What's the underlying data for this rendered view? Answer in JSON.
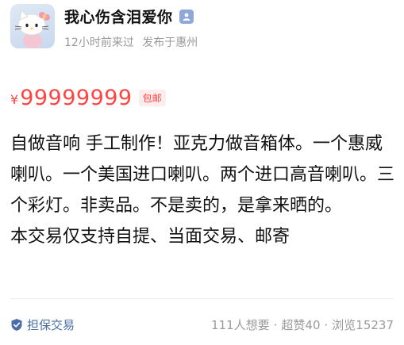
{
  "seller": {
    "name": "我心伤含泪爱你",
    "last_seen": "12小时前来过",
    "published_at": "发布于惠州",
    "avatar_icon": "hello-kitty-avatar",
    "verify_icon": "user-verified-icon"
  },
  "price": {
    "symbol": "¥",
    "value": "99999999",
    "shipping_tag": "包邮"
  },
  "description": {
    "lines": [
      "自做音响 手工制作！亚克力做音箱体。一个惠威喇叭。一个美国进口喇叭。两个进口高音喇叭。三个彩灯。非卖品。不是卖的，是拿来晒的。",
      "本交易仅支持自提、当面交易、邮寄"
    ]
  },
  "footer": {
    "guarantee_label": "担保交易",
    "guarantee_icon": "shield-check-icon",
    "wants": "111人想要",
    "likes": "超赞40",
    "views": "浏览15237",
    "separator": "·"
  },
  "colors": {
    "price": "#ff4444",
    "guarantee": "#4a6fa8",
    "muted": "#9a9a9a"
  }
}
